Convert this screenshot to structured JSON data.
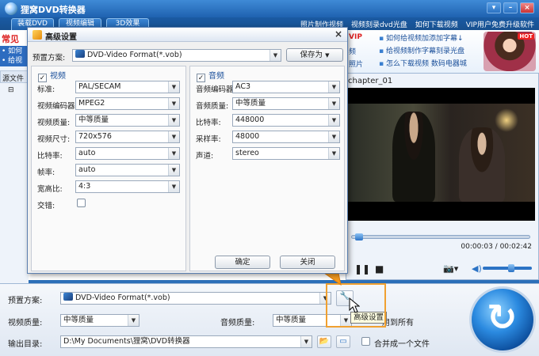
{
  "app": {
    "title": "狸窝DVD转换器",
    "tabs": [
      "装载DVD",
      "视频编辑",
      "3D效果"
    ],
    "top_links": [
      "照片制作视频",
      "视频刻录dvd光盘",
      "如何下载视频",
      "VIP用户免费升级软件"
    ]
  },
  "left": {
    "promo_text": "常见",
    "promo_links": [
      "• 如何",
      "• 给视"
    ],
    "source_label": "源文件",
    "tree_item": "⊟"
  },
  "banner": {
    "vip": "VIP",
    "partial": [
      "频",
      "照片"
    ],
    "links": [
      "如何给视频加添加字幕↓",
      "给视频制作字幕刻录光盘",
      "怎么下载视频  数码电器城"
    ],
    "hot_badge": "HOT"
  },
  "preview": {
    "chapter": "chapter_01",
    "time": "00:00:03 / 00:02:42",
    "progress": 0.02,
    "volume": 0.6
  },
  "bottom": {
    "preset_label": "预置方案:",
    "preset_value": "DVD-Video Format(*.vob)",
    "video_quality_label": "视频质量:",
    "video_quality_value": "中等质量",
    "audio_quality_label": "音频质量:",
    "audio_quality_value": "中等质量",
    "apply_all": "用到所有",
    "output_label": "输出目录:",
    "output_path": "D:\\My Documents\\狸窝\\DVD转换器",
    "merge_label": "合并成一个文件",
    "tooltip": "高级设置"
  },
  "dialog": {
    "title": "高级设置",
    "preset_label": "预置方案:",
    "preset_value": "DVD-Video Format(*.vob)",
    "save_as": "保存为",
    "video_header": "视频",
    "audio_header": "音频",
    "video_fields": [
      {
        "label": "标准:",
        "value": "PAL/SECAM"
      },
      {
        "label": "视频编码器:",
        "value": "MPEG2"
      },
      {
        "label": "视频质量:",
        "value": "中等质量"
      },
      {
        "label": "视频尺寸:",
        "value": "720x576"
      },
      {
        "label": "比特率:",
        "value": "auto"
      },
      {
        "label": "帧率:",
        "value": "auto"
      },
      {
        "label": "宽高比:",
        "value": "4:3"
      }
    ],
    "interlace_label": "交错:",
    "audio_fields": [
      {
        "label": "音频编码器:",
        "value": "AC3"
      },
      {
        "label": "音频质量:",
        "value": "中等质量"
      },
      {
        "label": "比特率:",
        "value": "448000"
      },
      {
        "label": "采样率:",
        "value": "48000"
      },
      {
        "label": "声道:",
        "value": "stereo"
      }
    ],
    "ok": "确定",
    "cancel": "关闭"
  },
  "colors": {
    "accent": "#2b6fb8",
    "arrow": "#f39a1f",
    "highlight": "#f0a030"
  }
}
